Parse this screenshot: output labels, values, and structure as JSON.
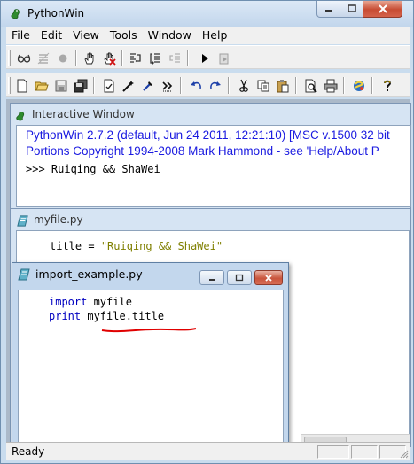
{
  "app": {
    "title": "PythonWin"
  },
  "menubar": {
    "items": [
      "File",
      "Edit",
      "View",
      "Tools",
      "Window",
      "Help"
    ]
  },
  "toolbar1": {
    "icons": [
      "watch-glasses-icon",
      "breakpoints-list-icon",
      "record-dot-icon",
      "hand-icon",
      "hand-cross-icon",
      "step-in-icon",
      "step-over-icon",
      "step-out-icon",
      "run-arrow-icon",
      "stop-run-icon"
    ]
  },
  "toolbar2": {
    "icons": [
      "new-file-icon",
      "open-folder-icon",
      "save-disk-icon",
      "save-all-icon",
      "check-icon",
      "wand-icon",
      "tools-icon",
      "double-chevron-icon",
      "undo-icon",
      "redo-icon",
      "cut-icon",
      "copy-icon",
      "paste-icon",
      "print-preview-icon",
      "print-icon",
      "python-browse-icon",
      "help-icon"
    ]
  },
  "interactive": {
    "caption": "Interactive Window",
    "lines": [
      "PythonWin 2.7.2 (default, Jun 24 2011, 12:21:10) [MSC v.1500 32 bit",
      "Portions Copyright 1994-2008 Mark Hammond - see 'Help/About P",
      ">>> Ruiqing && ShaWei"
    ]
  },
  "myfile": {
    "caption": "myfile.py",
    "code": {
      "ident": "title",
      "op": " = ",
      "string": "\"Ruiqing && ShaWei\""
    }
  },
  "example": {
    "caption": "import_example.py",
    "line1": {
      "kw": "import",
      "rest": " myfile"
    },
    "line2": {
      "kw": "print",
      "rest": " myfile.title"
    }
  },
  "status": {
    "text": "Ready"
  },
  "colors": {
    "keyword": "#0000c0",
    "string": "#7f7f00",
    "interactive_text": "#1a1ae0",
    "underline": "#e00000"
  }
}
